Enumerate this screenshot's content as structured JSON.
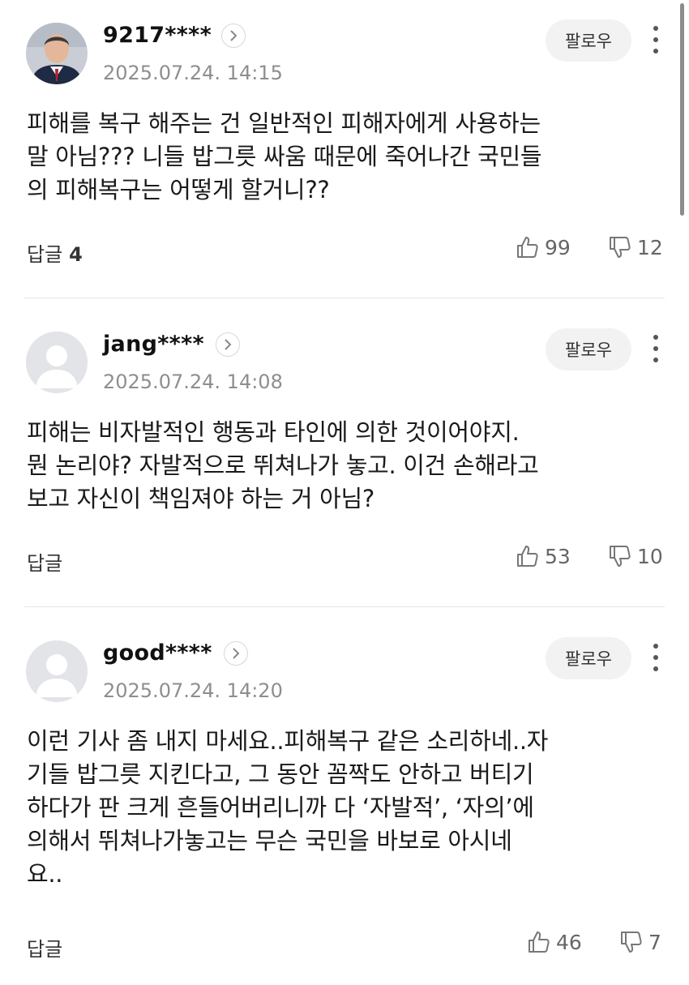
{
  "comments": [
    {
      "nickname": "9217****",
      "date": "2025.07.24. 14:15",
      "follow_label": "팔로우",
      "text": "피해를 복구 해주는 건 일반적인 피해자에게 사용하는\n말 아님??? 니들 밥그릇 싸움 때문에 죽어나간 국민들\n의 피해복구는 어떻게 할거니??",
      "reply_label": "답글",
      "reply_count": "4",
      "likes": "99",
      "dislikes": "12",
      "avatar": "profile-photo"
    },
    {
      "nickname": "jang****",
      "date": "2025.07.24. 14:08",
      "follow_label": "팔로우",
      "text": "피해는 비자발적인 행동과 타인에 의한 것이어야지.\n뭔 논리야? 자발적으로 뛰쳐나가 놓고. 이건 손해라고\n보고 자신이 책임져야 하는 거 아님?",
      "reply_label": "답글",
      "likes": "53",
      "dislikes": "10",
      "avatar": "default-avatar-icon"
    },
    {
      "nickname": "good****",
      "date": "2025.07.24. 14:20",
      "follow_label": "팔로우",
      "text": "이런 기사 좀 내지 마세요..피해복구 같은 소리하네..자\n기들 밥그릇 지킨다고, 그 동안 꼼짝도 안하고 버티기\n하다가 판 크게 흔들어버리니까 다 ‘자발적’, ‘자의’에\n의해서 뛰쳐나가놓고는 무슨 국민을 바보로 아시네\n요..",
      "reply_label": "답글",
      "likes": "46",
      "dislikes": "7",
      "avatar": "default-avatar-icon"
    }
  ],
  "icons": {
    "like": "thumbs-up-icon",
    "dislike": "thumbs-down-icon",
    "more": "more-vertical-icon",
    "profile_link": "chevron-right-icon"
  }
}
